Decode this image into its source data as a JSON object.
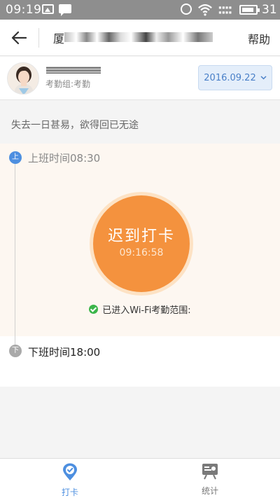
{
  "status_bar": {
    "time": "09:19",
    "battery": "31"
  },
  "header": {
    "title": "厦",
    "help_label": "帮助"
  },
  "user": {
    "group": "考勤组:考勤"
  },
  "date_picker": {
    "value": "2016.09.22"
  },
  "motto": "失去一日甚易，欲得回已无途",
  "timeline": {
    "on_duty_badge": "上",
    "on_duty_label": "上班时间08:30",
    "punch_label": "迟到打卡",
    "punch_time": "09:16:58",
    "wifi_status": "已进入Wi-Fi考勤范围:",
    "off_duty_badge": "下",
    "off_duty_label": "下班时间18:00"
  },
  "nav": {
    "punch_label": "打卡",
    "stats_label": "统计"
  },
  "colors": {
    "accent": "#4d8fe0",
    "punch": "#f4923e",
    "wifi_ok": "#3bb54a"
  }
}
